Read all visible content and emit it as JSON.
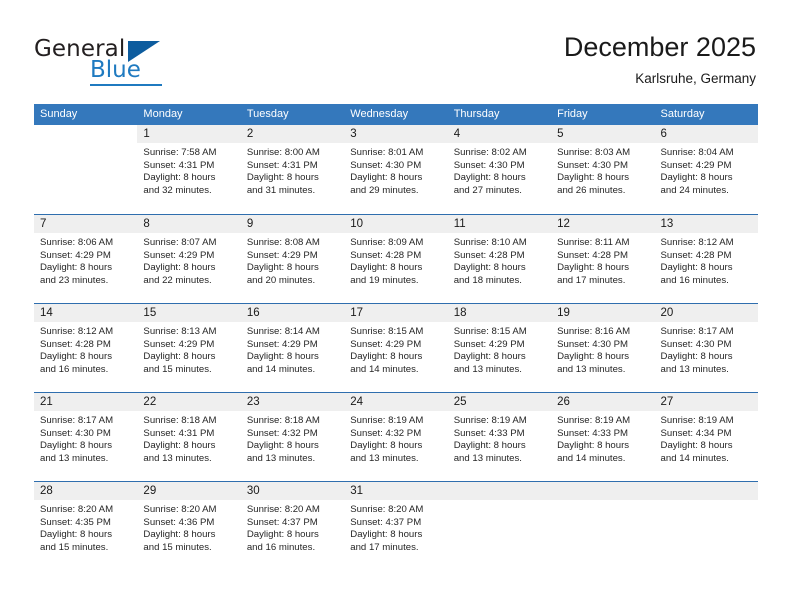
{
  "brand": {
    "name_part1": "General",
    "name_part2": "Blue",
    "logo_icon": "triangle-logo-icon",
    "accent_color": "#1f7ac0",
    "dark_color": "#0d5c9e"
  },
  "header": {
    "title": "December 2025",
    "subtitle": "Karlsruhe, Germany"
  },
  "calendar": {
    "header_color": "#3478bc",
    "weekday_headers": [
      "Sunday",
      "Monday",
      "Tuesday",
      "Wednesday",
      "Thursday",
      "Friday",
      "Saturday"
    ],
    "weeks": [
      [
        {
          "day": "",
          "lines": []
        },
        {
          "day": "1",
          "lines": [
            "Sunrise: 7:58 AM",
            "Sunset: 4:31 PM",
            "Daylight: 8 hours",
            "and 32 minutes."
          ]
        },
        {
          "day": "2",
          "lines": [
            "Sunrise: 8:00 AM",
            "Sunset: 4:31 PM",
            "Daylight: 8 hours",
            "and 31 minutes."
          ]
        },
        {
          "day": "3",
          "lines": [
            "Sunrise: 8:01 AM",
            "Sunset: 4:30 PM",
            "Daylight: 8 hours",
            "and 29 minutes."
          ]
        },
        {
          "day": "4",
          "lines": [
            "Sunrise: 8:02 AM",
            "Sunset: 4:30 PM",
            "Daylight: 8 hours",
            "and 27 minutes."
          ]
        },
        {
          "day": "5",
          "lines": [
            "Sunrise: 8:03 AM",
            "Sunset: 4:30 PM",
            "Daylight: 8 hours",
            "and 26 minutes."
          ]
        },
        {
          "day": "6",
          "lines": [
            "Sunrise: 8:04 AM",
            "Sunset: 4:29 PM",
            "Daylight: 8 hours",
            "and 24 minutes."
          ]
        }
      ],
      [
        {
          "day": "7",
          "lines": [
            "Sunrise: 8:06 AM",
            "Sunset: 4:29 PM",
            "Daylight: 8 hours",
            "and 23 minutes."
          ]
        },
        {
          "day": "8",
          "lines": [
            "Sunrise: 8:07 AM",
            "Sunset: 4:29 PM",
            "Daylight: 8 hours",
            "and 22 minutes."
          ]
        },
        {
          "day": "9",
          "lines": [
            "Sunrise: 8:08 AM",
            "Sunset: 4:29 PM",
            "Daylight: 8 hours",
            "and 20 minutes."
          ]
        },
        {
          "day": "10",
          "lines": [
            "Sunrise: 8:09 AM",
            "Sunset: 4:28 PM",
            "Daylight: 8 hours",
            "and 19 minutes."
          ]
        },
        {
          "day": "11",
          "lines": [
            "Sunrise: 8:10 AM",
            "Sunset: 4:28 PM",
            "Daylight: 8 hours",
            "and 18 minutes."
          ]
        },
        {
          "day": "12",
          "lines": [
            "Sunrise: 8:11 AM",
            "Sunset: 4:28 PM",
            "Daylight: 8 hours",
            "and 17 minutes."
          ]
        },
        {
          "day": "13",
          "lines": [
            "Sunrise: 8:12 AM",
            "Sunset: 4:28 PM",
            "Daylight: 8 hours",
            "and 16 minutes."
          ]
        }
      ],
      [
        {
          "day": "14",
          "lines": [
            "Sunrise: 8:12 AM",
            "Sunset: 4:28 PM",
            "Daylight: 8 hours",
            "and 16 minutes."
          ]
        },
        {
          "day": "15",
          "lines": [
            "Sunrise: 8:13 AM",
            "Sunset: 4:29 PM",
            "Daylight: 8 hours",
            "and 15 minutes."
          ]
        },
        {
          "day": "16",
          "lines": [
            "Sunrise: 8:14 AM",
            "Sunset: 4:29 PM",
            "Daylight: 8 hours",
            "and 14 minutes."
          ]
        },
        {
          "day": "17",
          "lines": [
            "Sunrise: 8:15 AM",
            "Sunset: 4:29 PM",
            "Daylight: 8 hours",
            "and 14 minutes."
          ]
        },
        {
          "day": "18",
          "lines": [
            "Sunrise: 8:15 AM",
            "Sunset: 4:29 PM",
            "Daylight: 8 hours",
            "and 13 minutes."
          ]
        },
        {
          "day": "19",
          "lines": [
            "Sunrise: 8:16 AM",
            "Sunset: 4:30 PM",
            "Daylight: 8 hours",
            "and 13 minutes."
          ]
        },
        {
          "day": "20",
          "lines": [
            "Sunrise: 8:17 AM",
            "Sunset: 4:30 PM",
            "Daylight: 8 hours",
            "and 13 minutes."
          ]
        }
      ],
      [
        {
          "day": "21",
          "lines": [
            "Sunrise: 8:17 AM",
            "Sunset: 4:30 PM",
            "Daylight: 8 hours",
            "and 13 minutes."
          ]
        },
        {
          "day": "22",
          "lines": [
            "Sunrise: 8:18 AM",
            "Sunset: 4:31 PM",
            "Daylight: 8 hours",
            "and 13 minutes."
          ]
        },
        {
          "day": "23",
          "lines": [
            "Sunrise: 8:18 AM",
            "Sunset: 4:32 PM",
            "Daylight: 8 hours",
            "and 13 minutes."
          ]
        },
        {
          "day": "24",
          "lines": [
            "Sunrise: 8:19 AM",
            "Sunset: 4:32 PM",
            "Daylight: 8 hours",
            "and 13 minutes."
          ]
        },
        {
          "day": "25",
          "lines": [
            "Sunrise: 8:19 AM",
            "Sunset: 4:33 PM",
            "Daylight: 8 hours",
            "and 13 minutes."
          ]
        },
        {
          "day": "26",
          "lines": [
            "Sunrise: 8:19 AM",
            "Sunset: 4:33 PM",
            "Daylight: 8 hours",
            "and 14 minutes."
          ]
        },
        {
          "day": "27",
          "lines": [
            "Sunrise: 8:19 AM",
            "Sunset: 4:34 PM",
            "Daylight: 8 hours",
            "and 14 minutes."
          ]
        }
      ],
      [
        {
          "day": "28",
          "lines": [
            "Sunrise: 8:20 AM",
            "Sunset: 4:35 PM",
            "Daylight: 8 hours",
            "and 15 minutes."
          ]
        },
        {
          "day": "29",
          "lines": [
            "Sunrise: 8:20 AM",
            "Sunset: 4:36 PM",
            "Daylight: 8 hours",
            "and 15 minutes."
          ]
        },
        {
          "day": "30",
          "lines": [
            "Sunrise: 8:20 AM",
            "Sunset: 4:37 PM",
            "Daylight: 8 hours",
            "and 16 minutes."
          ]
        },
        {
          "day": "31",
          "lines": [
            "Sunrise: 8:20 AM",
            "Sunset: 4:37 PM",
            "Daylight: 8 hours",
            "and 17 minutes."
          ]
        },
        {
          "day": "",
          "lines": []
        },
        {
          "day": "",
          "lines": []
        },
        {
          "day": "",
          "lines": []
        }
      ]
    ]
  }
}
